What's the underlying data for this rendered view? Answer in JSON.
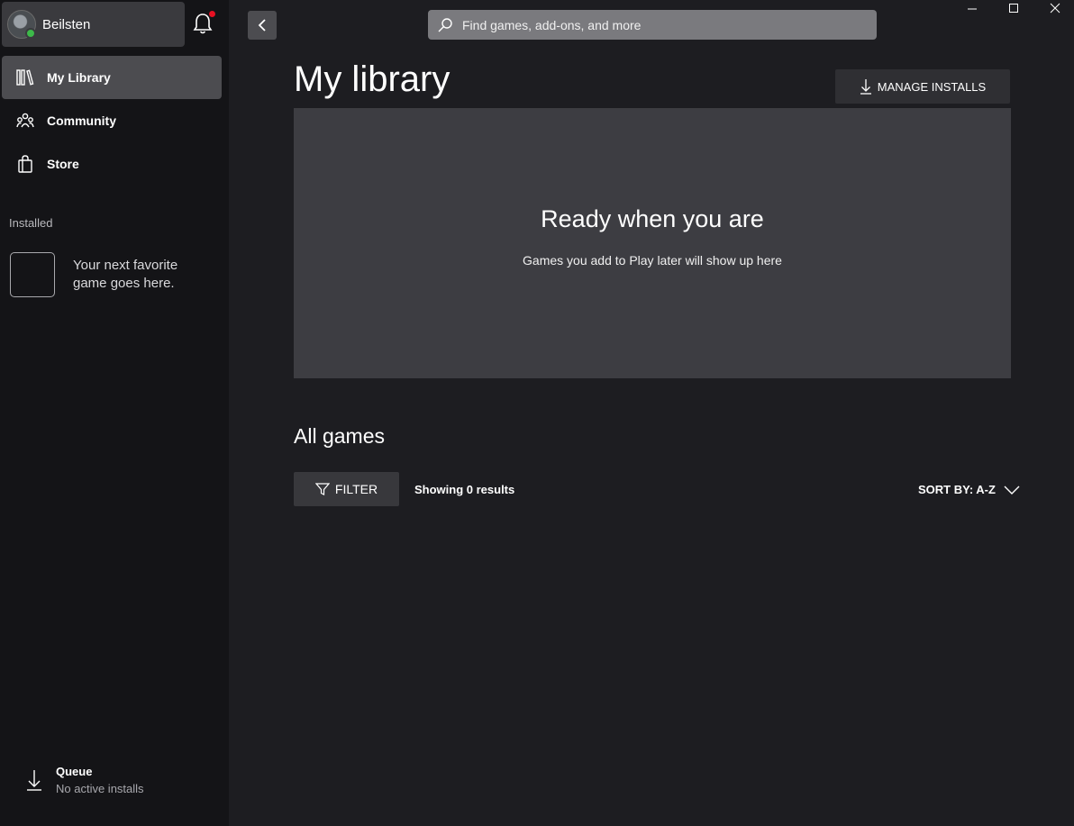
{
  "sidebar": {
    "profile": {
      "name": "Beilsten",
      "status_color": "#3db94a"
    },
    "notification_dot_color": "#e81123",
    "nav": [
      {
        "label": "My Library",
        "icon": "library-icon",
        "active": true
      },
      {
        "label": "Community",
        "icon": "community-icon",
        "active": false
      },
      {
        "label": "Store",
        "icon": "store-icon",
        "active": false
      }
    ],
    "installed_label": "Installed",
    "installed_placeholder": "Your next favorite game goes here.",
    "queue": {
      "title": "Queue",
      "status": "No active installs"
    }
  },
  "header": {
    "search_placeholder": "Find games, add-ons, and more"
  },
  "main": {
    "title": "My library",
    "manage_installs_label": "MANAGE INSTALLS",
    "hero": {
      "heading": "Ready when you are",
      "subtext": "Games you add to Play later will show up here"
    },
    "all_games_title": "All games",
    "filter_label": "FILTER",
    "results_text": "Showing 0 results",
    "sort_label": "SORT BY: A-Z"
  },
  "colors": {
    "background": "#1d1d21",
    "sidebar": "#141417",
    "active_nav": "#4c4c50",
    "hero": "#3d3d42"
  }
}
